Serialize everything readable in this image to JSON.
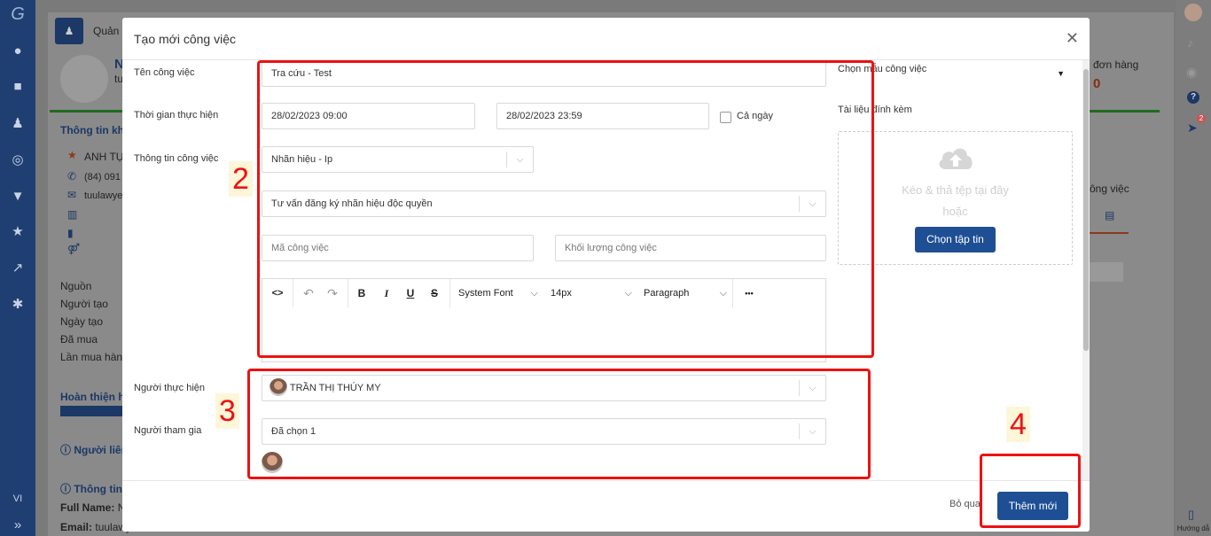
{
  "background": {
    "header_partial": "Quản l",
    "profile_name_partial": "N",
    "profile_sub_partial": "tu",
    "orders_label_partial": "đơn hàng",
    "orders_count": "0",
    "customer_info_partial": "Thông tin khá",
    "customer_name_partial": "ANH TỤ",
    "customer_phone_partial": "(84) 091",
    "customer_email_partial": "tuulawye",
    "fields": [
      "Nguồn",
      "Người tạo",
      "Ngày tạo",
      "Đã mua",
      "Lần mua hàng"
    ],
    "complete_partial": "Hoàn thiện h",
    "contact_partial": "Người liên",
    "info_partial": "Thông tin c",
    "full_name_label": "Full Name:",
    "full_name_partial": "N",
    "email_label": "Email:",
    "email_partial": "tuulawy",
    "right_tab_partial": "ông việc",
    "lang": "VI",
    "help_label": "Hướng dẫ",
    "badge_count": "2"
  },
  "modal": {
    "title": "Tạo mới công việc",
    "close_icon": "close-icon",
    "task_name_label": "Tên công việc",
    "task_name_value": "Tra cứu - Test",
    "time_label": "Thời gian thực hiện",
    "start_time": "28/02/2023 09:00",
    "end_time": "28/02/2023 23:59",
    "all_day_label": "Cả ngày",
    "all_day_checked": false,
    "work_info_label": "Thông tin công việc",
    "category_value": "Nhãn hiệu - Ip",
    "service_value": "Tư vấn đăng ký nhãn hiệu độc quyền",
    "task_code_placeholder": "Mã công việc",
    "workload_placeholder": "Khối lượng công việc",
    "editor": {
      "font": "System Font",
      "size": "14px",
      "block": "Paragraph",
      "more": "•••"
    },
    "assignee_label": "Người thực hiện",
    "assignee_value": "TRẦN THỊ THÚY MY",
    "participants_label": "Người tham gia",
    "participants_value": "Đã chọn 1",
    "template_label": "Chọn mẫu công việc",
    "attachment_label": "Tài liệu đính kèm",
    "drop_text_1": "Kéo & thả tệp tại đây",
    "drop_text_2": "hoặc",
    "choose_file_label": "Chọn tập tin",
    "skip_label": "Bỏ qua",
    "submit_label": "Thêm mới"
  },
  "annotations": {
    "n2": "2",
    "n3": "3",
    "n4": "4"
  },
  "colors": {
    "primary": "#1e4f94",
    "annotation": "#ee1111",
    "nav": "#1f3f73"
  }
}
